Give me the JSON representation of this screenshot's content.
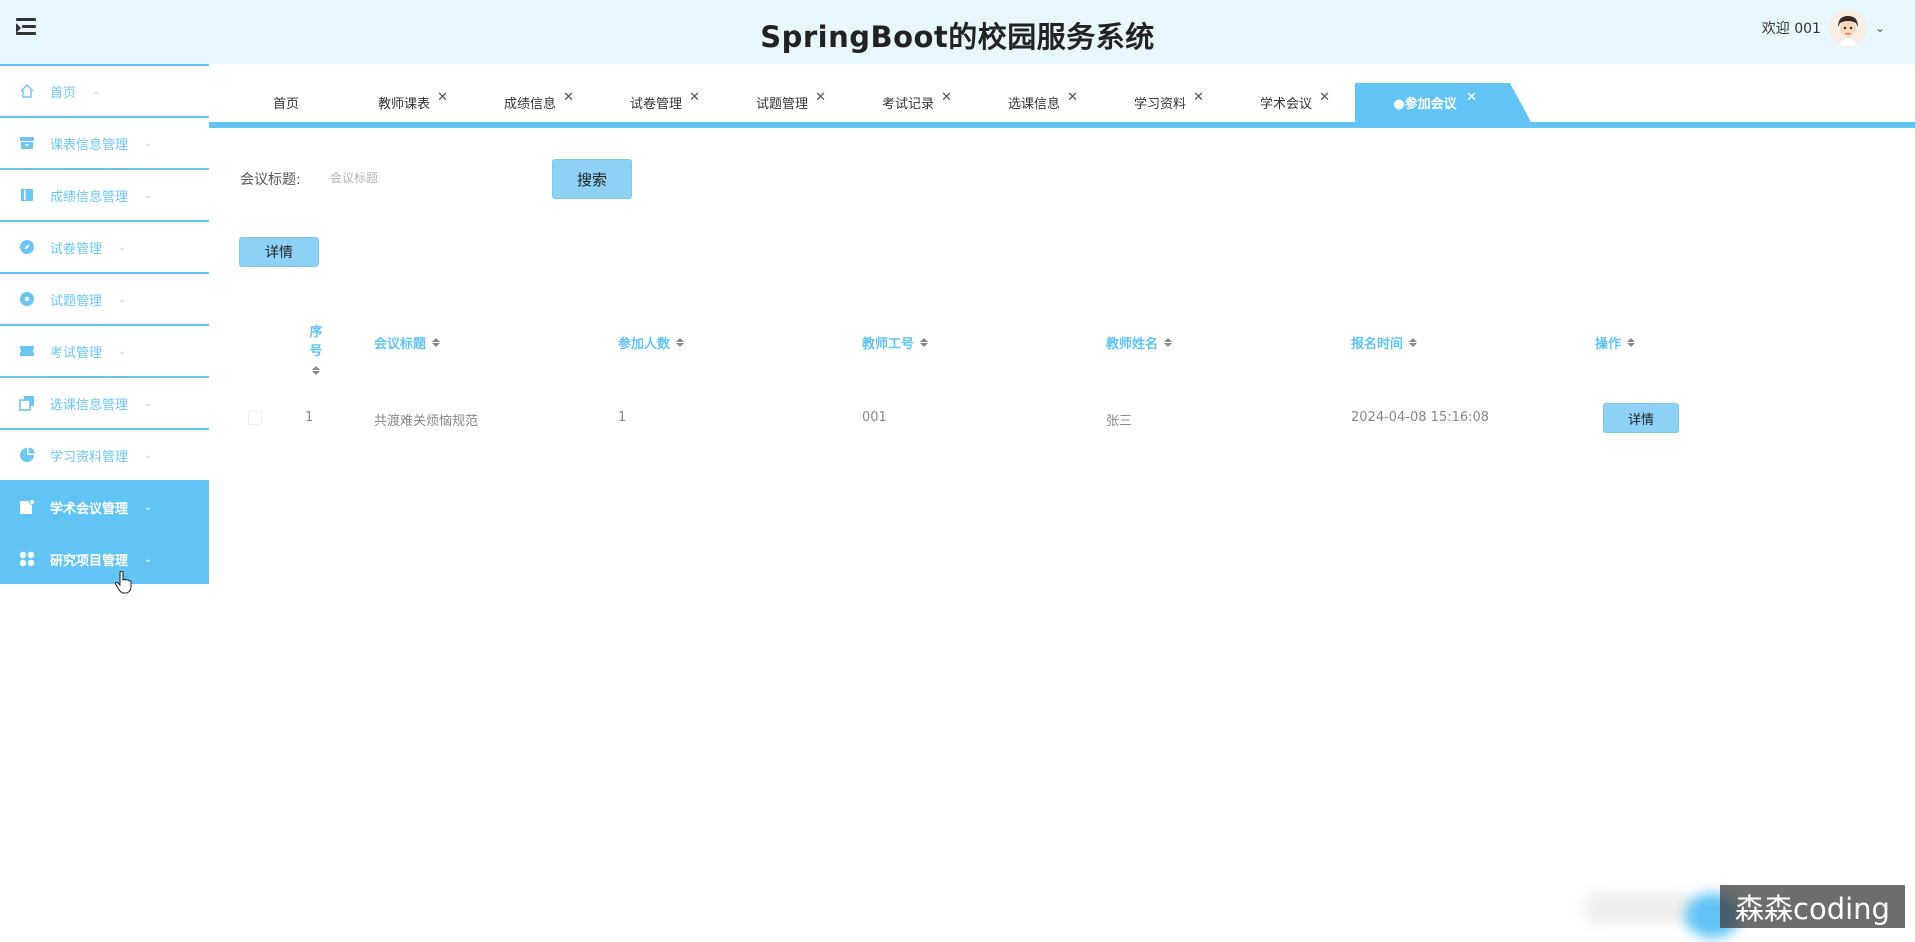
{
  "header": {
    "title": "SpringBoot的校园服务系统",
    "welcome": "欢迎 001"
  },
  "sidebar": {
    "items": [
      {
        "label": "首页",
        "icon": "home-icon",
        "active": false
      },
      {
        "label": "课表信息管理",
        "icon": "archive-icon",
        "active": false
      },
      {
        "label": "成绩信息管理",
        "icon": "book-icon",
        "active": false
      },
      {
        "label": "试卷管理",
        "icon": "compass-icon",
        "active": false
      },
      {
        "label": "试题管理",
        "icon": "target-icon",
        "active": false
      },
      {
        "label": "考试管理",
        "icon": "ticket-icon",
        "active": false
      },
      {
        "label": "选课信息管理",
        "icon": "copy-icon",
        "active": false
      },
      {
        "label": "学习资料管理",
        "icon": "pie-icon",
        "active": false
      },
      {
        "label": "学术会议管理",
        "icon": "edit-doc-icon",
        "active": true
      },
      {
        "label": "研究项目管理",
        "icon": "grid-icon",
        "active": true
      }
    ]
  },
  "tabs": [
    {
      "label": "首页",
      "closable": false,
      "active": false
    },
    {
      "label": "教师课表",
      "closable": true,
      "active": false
    },
    {
      "label": "成绩信息",
      "closable": true,
      "active": false
    },
    {
      "label": "试卷管理",
      "closable": true,
      "active": false
    },
    {
      "label": "试题管理",
      "closable": true,
      "active": false
    },
    {
      "label": "考试记录",
      "closable": true,
      "active": false
    },
    {
      "label": "选课信息",
      "closable": true,
      "active": false
    },
    {
      "label": "学习资料",
      "closable": true,
      "active": false
    },
    {
      "label": "学术会议",
      "closable": true,
      "active": false
    },
    {
      "label": "●参加会议",
      "closable": true,
      "active": true
    }
  ],
  "search": {
    "label": "会议标题:",
    "placeholder": "会议标题",
    "button": "搜索"
  },
  "toolbar": {
    "detail_button": "详情"
  },
  "table": {
    "columns": [
      "序号",
      "会议标题",
      "参加人数",
      "教师工号",
      "教师姓名",
      "报名时间",
      "操作"
    ],
    "rows": [
      {
        "seq": "1",
        "title": "共渡难关烦恼规范",
        "count": "1",
        "teacher_id": "001",
        "teacher_name": "张三",
        "time": "2024-04-08 15:16:08",
        "action": "详情"
      }
    ]
  },
  "watermark": "森森coding",
  "colors": {
    "accent": "#61c4f5",
    "button": "#8dd1f5",
    "header_bg": "#e8f6fd"
  }
}
